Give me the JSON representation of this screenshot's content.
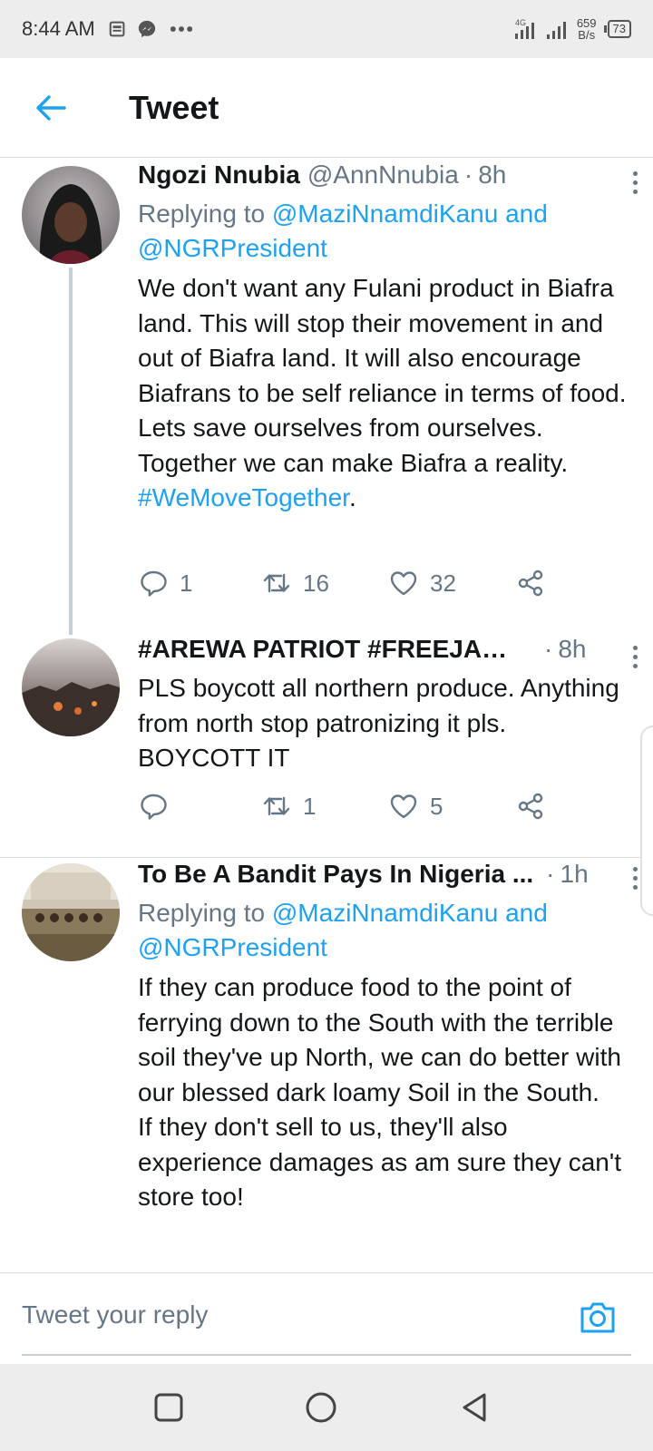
{
  "status_bar": {
    "time": "8:44 AM",
    "network": "4G",
    "speed_value": "659",
    "speed_unit": "B/s",
    "battery": "73"
  },
  "header": {
    "title": "Tweet"
  },
  "tweets": [
    {
      "name": "Ngozi Nnubia",
      "handle": "@AnnNnubia",
      "sep": "·",
      "time": "8h",
      "replying_prefix": "Replying to",
      "replying_user1": "@MaziNnamdiKanu",
      "replying_and": "and",
      "replying_user2": "@NGRPresident",
      "text": "We don't want any Fulani product in Biafra land. This will stop their movement in and out of Biafra land. It will also encourage Biafrans to be self reliance in terms of food. Lets save ourselves from ourselves. Together we can make Biafra a reality.",
      "hashtag": "#WeMoveTogether",
      "text_end": ".",
      "replies": "1",
      "retweets": "16",
      "likes": "32"
    },
    {
      "name": "#AREWA PATRIOT #FREEJAN...",
      "sep": "·",
      "time": "8h",
      "text": "PLS boycott all northern produce. Anything from north stop patronizing it pls. BOYCOTT IT",
      "replies": "",
      "retweets": "1",
      "likes": "5"
    },
    {
      "name": "To Be A Bandit Pays In Nigeria ...",
      "sep": "·",
      "time": "1h",
      "replying_prefix": "Replying to",
      "replying_user1": "@MaziNnamdiKanu",
      "replying_and": "and",
      "replying_user2": "@NGRPresident",
      "text_p1": "If they can produce food to the point of ferrying down to the South with the terrible soil they've up North, we can do better with our blessed dark loamy Soil in the South.",
      "text_p2": "If they don't sell to us, they'll also experience damages as am sure they can't store too!"
    }
  ],
  "reply_bar": {
    "placeholder": "Tweet your reply"
  },
  "colors": {
    "accent": "#1da1f2",
    "secondary_text": "#657786",
    "primary_text": "#14171a"
  },
  "icons": [
    "back-arrow-icon",
    "reply-icon",
    "retweet-icon",
    "like-icon",
    "share-icon",
    "more-icon",
    "camera-icon",
    "square-icon",
    "circle-icon",
    "triangle-back-icon"
  ]
}
